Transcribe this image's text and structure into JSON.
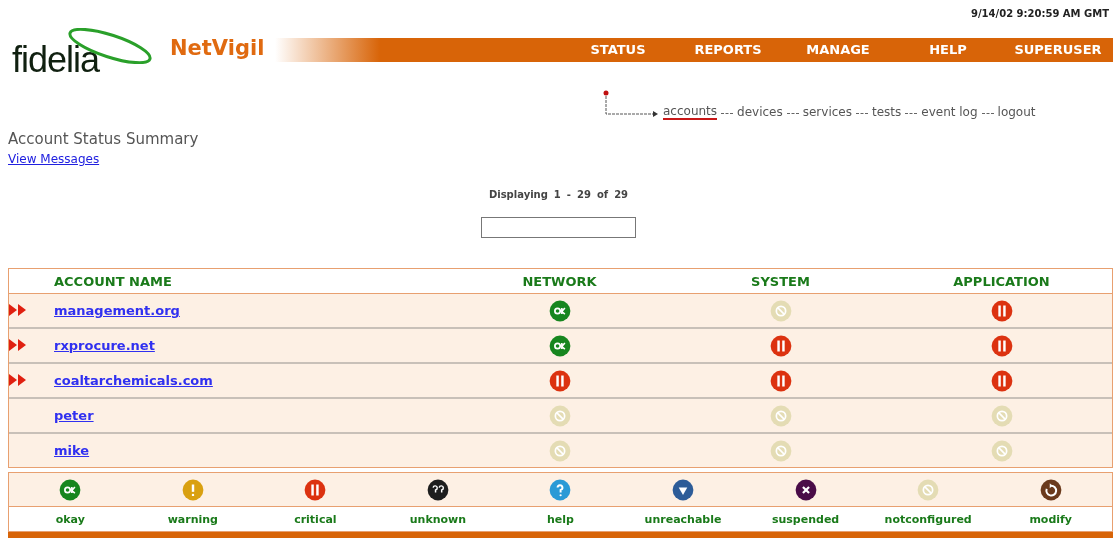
{
  "header": {
    "datetime": "9/14/02 9:20:59 AM GMT",
    "logo": "fidelia",
    "product": "NetVigil",
    "nav": [
      "STATUS",
      "REPORTS",
      "MANAGE",
      "HELP",
      "SUPERUSER"
    ]
  },
  "breadcrumb": [
    {
      "label": "accounts",
      "selected": true
    },
    {
      "label": "devices",
      "selected": false
    },
    {
      "label": "services",
      "selected": false
    },
    {
      "label": "tests",
      "selected": false
    },
    {
      "label": "event log",
      "selected": false
    },
    {
      "label": "logout",
      "selected": false
    }
  ],
  "page_title": "Account Status Summary",
  "view_messages_link": "View Messages",
  "pagination": {
    "label": "Displaying",
    "from": "1",
    "separator": "-",
    "to": "29",
    "of_label": "of",
    "total": "29"
  },
  "table": {
    "columns": [
      "ACCOUNT NAME",
      "NETWORK",
      "SYSTEM",
      "APPLICATION"
    ],
    "rows": [
      {
        "name": "management.org",
        "flagged": true,
        "cells": [
          {
            "kind": "okay"
          },
          {
            "kind": "notconfigured"
          },
          {
            "kind": "critical"
          }
        ]
      },
      {
        "name": "rxprocure.net",
        "flagged": true,
        "cells": [
          {
            "kind": "okay"
          },
          {
            "kind": "critical"
          },
          {
            "kind": "critical"
          }
        ]
      },
      {
        "name": "coaltarchemicals.com",
        "flagged": true,
        "cells": [
          {
            "kind": "critical"
          },
          {
            "kind": "critical"
          },
          {
            "kind": "critical"
          }
        ]
      },
      {
        "name": "peter",
        "flagged": false,
        "cells": [
          {
            "kind": "notconfigured"
          },
          {
            "kind": "notconfigured"
          },
          {
            "kind": "notconfigured"
          }
        ]
      },
      {
        "name": "mike",
        "flagged": false,
        "cells": [
          {
            "kind": "notconfigured"
          },
          {
            "kind": "notconfigured"
          },
          {
            "kind": "notconfigured"
          }
        ]
      }
    ]
  },
  "legend": [
    {
      "kind": "okay",
      "label": "okay"
    },
    {
      "kind": "warning",
      "label": "warning"
    },
    {
      "kind": "critical",
      "label": "critical"
    },
    {
      "kind": "unknown",
      "label": "unknown"
    },
    {
      "kind": "help",
      "label": "help"
    },
    {
      "kind": "unreachable",
      "label": "unreachable"
    },
    {
      "kind": "suspended",
      "label": "suspended"
    },
    {
      "kind": "notconfigured",
      "label": "notconfigured"
    },
    {
      "kind": "modify",
      "label": "modify"
    }
  ]
}
